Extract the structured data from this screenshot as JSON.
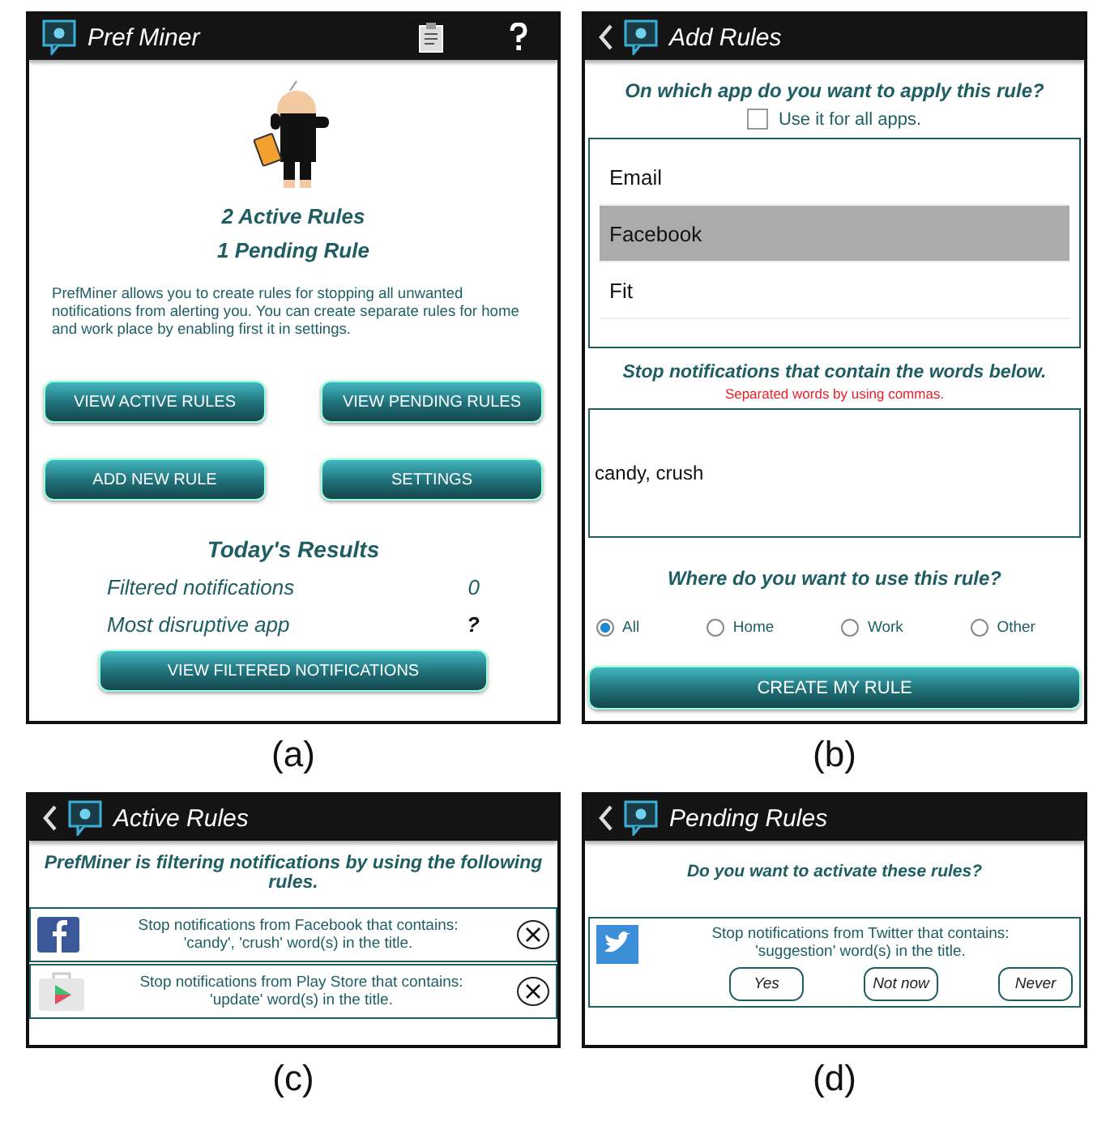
{
  "home": {
    "caption": "(a)",
    "title": "Pref Miner",
    "active_count": "2 Active Rules",
    "pending_count": "1 Pending Rule",
    "description": "PrefMiner allows you to create rules for stopping all unwanted notifications from alerting you. You can create separate rules for home and work place by enabling first it in settings.",
    "buttons": [
      "VIEW ACTIVE RULES",
      "VIEW PENDING RULES",
      "ADD NEW RULE",
      "SETTINGS"
    ],
    "results_title": "Today's Results",
    "results": [
      {
        "label": "Filtered notifications",
        "value": "0",
        "kind": "number"
      },
      {
        "label": "Most disruptive app",
        "value": "?",
        "kind": "unknown"
      }
    ],
    "bottom_button": "VIEW FILTERED NOTIFICATIONS"
  },
  "add_rules": {
    "caption": "(b)",
    "title": "Add Rules",
    "question": "On which app do you want to apply this rule?",
    "all_apps": {
      "label": "Use it for all apps.",
      "checked": false
    },
    "apps": [
      {
        "label": "Email",
        "selected": false
      },
      {
        "label": "Facebook",
        "selected": true
      },
      {
        "label": "Fit",
        "selected": false
      }
    ],
    "words_title": "Stop notifications that contain the words below.",
    "words_hint": "Separated words by using commas.",
    "words_value": "candy, crush",
    "where_title": "Where do you want to use this rule?",
    "places": [
      {
        "label": "All",
        "selected": true
      },
      {
        "label": "Home",
        "selected": false
      },
      {
        "label": "Work",
        "selected": false
      },
      {
        "label": "Other",
        "selected": false
      }
    ],
    "create_button": "CREATE MY RULE"
  },
  "active_rules": {
    "caption": "(c)",
    "title": "Active Rules",
    "intro": "PrefMiner is filtering notifications by using the following rules.",
    "rules": [
      {
        "kind": "facebook",
        "text": "Stop notifications from Facebook that contains: 'candy', 'crush' word(s) in the title."
      },
      {
        "kind": "playstore",
        "text": "Stop notifications from Play Store that contains: 'update' word(s) in the title."
      }
    ]
  },
  "pending_rules": {
    "caption": "(d)",
    "title": "Pending Rules",
    "question": "Do you want to activate these rules?",
    "rules": [
      {
        "kind": "twitter",
        "text": "Stop notifications from Twitter that contains: 'suggestion' word(s) in the title.",
        "actions": [
          "Yes",
          "Not now",
          "Never"
        ]
      }
    ]
  }
}
